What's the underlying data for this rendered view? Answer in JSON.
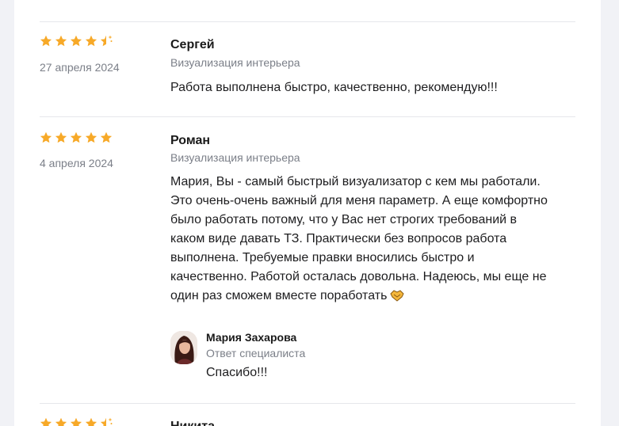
{
  "reviews": [
    {
      "rating": 4.5,
      "date": "27 апреля 2024",
      "author": "Сергей",
      "service": "Визуализация интерьера",
      "lines": [
        "Работа выполнена быстро, качественно, рекомендую!!!"
      ]
    },
    {
      "rating": 5,
      "date": "4 апреля 2024",
      "author": "Роман",
      "service": "Визуализация интерьера",
      "lines": [
        "Мария, Вы - самый быстрый визуализатор с кем мы работали.",
        "Это очень-очень важный для меня параметр. А еще комфортно",
        "было работать потому, что у Вас нет строгих требований в",
        "каком виде давать ТЗ. Практически без вопросов работа",
        "выполнена. Требуемые правки вносились быстро и",
        "качественно. Работой осталась довольна. Надеюсь, мы еще не",
        "один раз сможем вместе поработать"
      ],
      "reply": {
        "name": "Мария Захарова",
        "role": "Ответ специалиста",
        "text": "Спасибо!!!"
      }
    },
    {
      "rating": 4.5,
      "author": "Никита"
    }
  ],
  "colors": {
    "star": "#f7a928",
    "muted": "#7b7f88",
    "divider": "#e6e7eb"
  },
  "icons": {
    "star": "star-icon",
    "half_star": "star-half-sparkle-icon",
    "emoji": "handshake-emoji-icon"
  }
}
